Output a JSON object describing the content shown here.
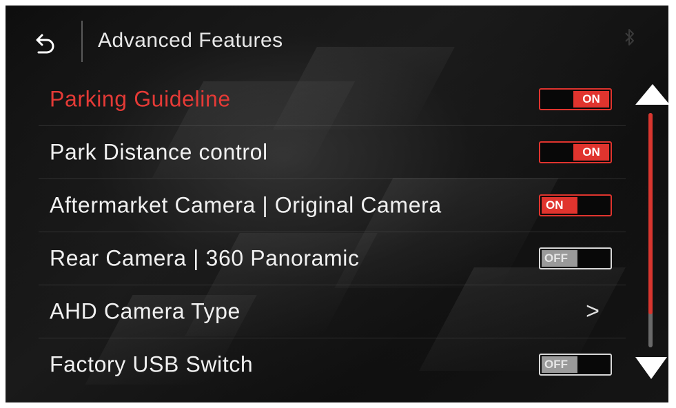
{
  "header": {
    "title": "Advanced Features",
    "back_icon": "back-arrow-icon",
    "status_icon": "bluetooth-icon"
  },
  "settings": [
    {
      "label": "Parking Guideline",
      "control": "toggle",
      "state": "ON",
      "active": true
    },
    {
      "label": "Park Distance control",
      "control": "toggle",
      "state": "ON",
      "active": false
    },
    {
      "label": "Aftermarket Camera | Original Camera",
      "control": "toggle",
      "state": "ON",
      "active": false
    },
    {
      "label": "Rear Camera | 360 Panoramic",
      "control": "toggle",
      "state": "OFF",
      "active": false
    },
    {
      "label": "AHD Camera Type",
      "control": "submenu",
      "chevron": ">",
      "active": false
    },
    {
      "label": "Factory USB Switch",
      "control": "toggle",
      "state": "OFF",
      "active": false
    }
  ],
  "scrollbar": {
    "up_icon": "scroll-up-arrow-icon",
    "down_icon": "scroll-down-arrow-icon",
    "position_fraction": 0.0,
    "visible_fraction": 0.86
  },
  "colors": {
    "accent": "#e0342e",
    "active_label": "#e43a36",
    "text": "#f0f0f0",
    "off_knob": "#9a9a9a"
  }
}
